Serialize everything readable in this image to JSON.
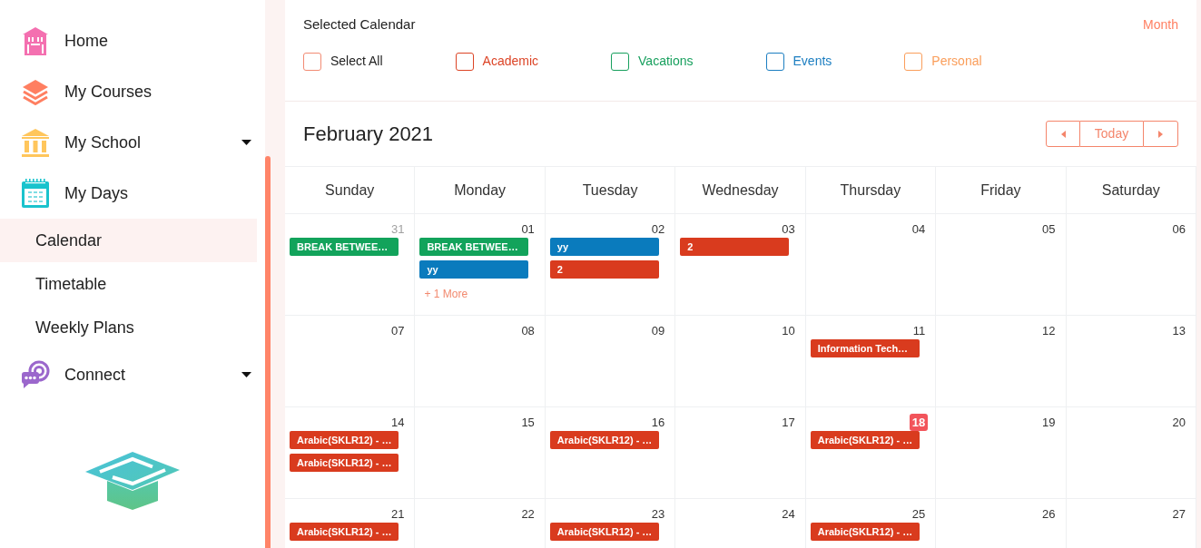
{
  "sidebar": {
    "items": [
      {
        "label": "Home"
      },
      {
        "label": "My Courses"
      },
      {
        "label": "My School",
        "collapsed": true
      },
      {
        "label": "My Days",
        "collapsed": false,
        "children": [
          {
            "label": "Calendar",
            "selected": true
          },
          {
            "label": "Timetable",
            "selected": false
          },
          {
            "label": "Weekly Plans",
            "selected": false
          }
        ]
      },
      {
        "label": "Connect",
        "collapsed": true
      }
    ]
  },
  "filters": {
    "title": "Selected Calendar",
    "view": "Month",
    "options": [
      {
        "kind": "all",
        "label": "Select All",
        "checked": false,
        "color": "#f28b73"
      },
      {
        "kind": "category",
        "label": "Academic",
        "checked": false,
        "color": "#dc4426"
      },
      {
        "kind": "category",
        "label": "Vacations",
        "checked": false,
        "color": "#18a05e"
      },
      {
        "kind": "category",
        "label": "Events",
        "checked": false,
        "color": "#1c7ec1"
      },
      {
        "kind": "category",
        "label": "Personal",
        "checked": false,
        "color": "#fa9e5b"
      }
    ]
  },
  "calendar": {
    "title": "February 2021",
    "today_button": "Today",
    "weekdays": [
      "Sunday",
      "Monday",
      "Tuesday",
      "Wednesday",
      "Thursday",
      "Friday",
      "Saturday"
    ],
    "weeks": [
      [
        {
          "day": "31",
          "outside": true,
          "today": false,
          "events": [
            {
              "title": "BREAK BETWEE…",
              "color": "#12a35b"
            }
          ]
        },
        {
          "day": "01",
          "outside": false,
          "today": false,
          "events": [
            {
              "title": "BREAK BETWEE…",
              "color": "#12a35b"
            },
            {
              "title": "yy",
              "color": "#0a7bbd"
            }
          ],
          "more": "+ 1 More"
        },
        {
          "day": "02",
          "outside": false,
          "today": false,
          "events": [
            {
              "title": "yy",
              "color": "#0a7bbd"
            },
            {
              "title": "2",
              "color": "#d93b1e"
            }
          ]
        },
        {
          "day": "03",
          "outside": false,
          "today": false,
          "events": [
            {
              "title": "2",
              "color": "#d93b1e"
            }
          ]
        },
        {
          "day": "04",
          "outside": false,
          "today": false
        },
        {
          "day": "05",
          "outside": false,
          "today": false
        },
        {
          "day": "06",
          "outside": false,
          "today": false
        }
      ],
      [
        {
          "day": "07",
          "outside": false,
          "today": false
        },
        {
          "day": "08",
          "outside": false,
          "today": false
        },
        {
          "day": "09",
          "outside": false,
          "today": false
        },
        {
          "day": "10",
          "outside": false,
          "today": false
        },
        {
          "day": "11",
          "outside": false,
          "today": false,
          "events": [
            {
              "title": "Information Tech…",
              "color": "#d93b1e"
            }
          ]
        },
        {
          "day": "12",
          "outside": false,
          "today": false
        },
        {
          "day": "13",
          "outside": false,
          "today": false
        }
      ],
      [
        {
          "day": "14",
          "outside": false,
          "today": false,
          "events": [
            {
              "title": "Arabic(SKLR12) - …",
              "color": "#d93b1e"
            },
            {
              "title": "Arabic(SKLR12) - …",
              "color": "#d93b1e"
            }
          ]
        },
        {
          "day": "15",
          "outside": false,
          "today": false
        },
        {
          "day": "16",
          "outside": false,
          "today": false,
          "events": [
            {
              "title": "Arabic(SKLR12) - …",
              "color": "#d93b1e"
            }
          ]
        },
        {
          "day": "17",
          "outside": false,
          "today": false
        },
        {
          "day": "18",
          "outside": false,
          "today": true,
          "events": [
            {
              "title": "Arabic(SKLR12) - …",
              "color": "#d93b1e"
            }
          ]
        },
        {
          "day": "19",
          "outside": false,
          "today": false
        },
        {
          "day": "20",
          "outside": false,
          "today": false
        }
      ],
      [
        {
          "day": "21",
          "outside": false,
          "today": false,
          "events": [
            {
              "title": "Arabic(SKLR12) - …",
              "color": "#d93b1e"
            }
          ]
        },
        {
          "day": "22",
          "outside": false,
          "today": false
        },
        {
          "day": "23",
          "outside": false,
          "today": false,
          "events": [
            {
              "title": "Arabic(SKLR12) - …",
              "color": "#d93b1e"
            }
          ]
        },
        {
          "day": "24",
          "outside": false,
          "today": false
        },
        {
          "day": "25",
          "outside": false,
          "today": false,
          "events": [
            {
              "title": "Arabic(SKLR12) - …",
              "color": "#d93b1e"
            }
          ]
        },
        {
          "day": "26",
          "outside": false,
          "today": false
        },
        {
          "day": "27",
          "outside": false,
          "today": false
        }
      ]
    ]
  }
}
